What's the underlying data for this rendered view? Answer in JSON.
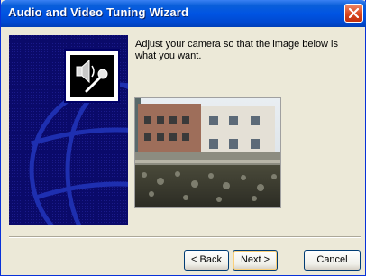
{
  "window": {
    "title": "Audio and Video Tuning Wizard"
  },
  "instructions": "Adjust your camera so that the image below is what you want.",
  "buttons": {
    "back": "< Back",
    "next": "Next >",
    "cancel": "Cancel"
  },
  "colors": {
    "titlebar": "#0054e3",
    "panel": "#0a0a6a",
    "window_bg": "#ece9d8"
  },
  "icons": {
    "close": "close-icon",
    "speaker": "speaker-icon",
    "microphone": "microphone-icon"
  }
}
